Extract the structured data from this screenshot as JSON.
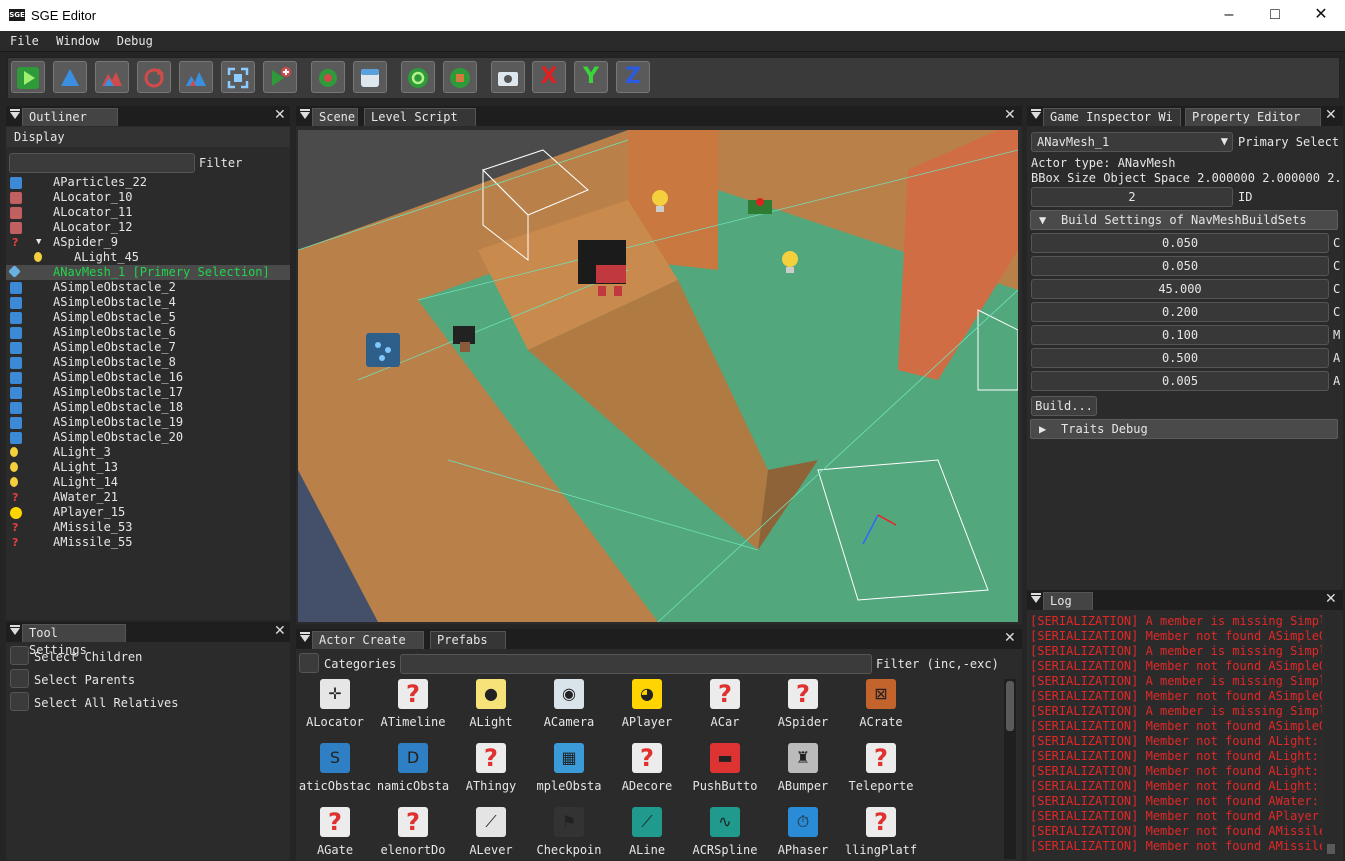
{
  "window": {
    "title": "SGE Editor",
    "logo": "SGE"
  },
  "menu": [
    "File",
    "Window",
    "Debug"
  ],
  "toolbar": {
    "buttons": [
      {
        "name": "play-button",
        "icon": "play-icon"
      },
      {
        "name": "translate-button",
        "icon": "arrow-up-icon"
      },
      {
        "name": "rotate-button",
        "icon": "mountains-icon"
      },
      {
        "name": "refresh-button",
        "icon": "rotate-icon"
      },
      {
        "name": "scale-button",
        "icon": "scale-icon"
      },
      {
        "name": "focus-button",
        "icon": "frame-icon"
      },
      {
        "name": "add-actor-button",
        "icon": "add-icon"
      },
      {
        "name": "snap-button",
        "icon": "snap-icon"
      },
      {
        "name": "window-button",
        "icon": "window-icon"
      },
      {
        "name": "reload-button",
        "icon": "reload-icon"
      },
      {
        "name": "reload-scripts-button",
        "icon": "recycle-icon"
      },
      {
        "name": "screenshot-button",
        "icon": "camera-icon"
      },
      {
        "name": "x-axis-button",
        "icon": "x-icon",
        "label": "X"
      },
      {
        "name": "y-axis-button",
        "icon": "y-icon",
        "label": "Y"
      },
      {
        "name": "z-axis-button",
        "icon": "z-icon",
        "label": "Z"
      }
    ]
  },
  "outliner": {
    "tab": "Outliner",
    "display": "Display",
    "filter_label": "Filter",
    "filter_value": "",
    "items": [
      {
        "label": "AParticles_22",
        "icon": "particles-icon",
        "indent": 0
      },
      {
        "label": "ALocator_10",
        "icon": "locator-icon",
        "indent": 0
      },
      {
        "label": "ALocator_11",
        "icon": "locator-icon",
        "indent": 0
      },
      {
        "label": "ALocator_12",
        "icon": "locator-icon",
        "indent": 0
      },
      {
        "label": "ASpider_9",
        "icon": "question-icon",
        "indent": 0,
        "arrow": "▼"
      },
      {
        "label": "ALight_45",
        "icon": "bulb-icon",
        "indent": 1
      },
      {
        "label": "ANavMesh_1 [Primery Selection]",
        "icon": "navmesh-icon",
        "indent": 0,
        "selected": true
      },
      {
        "label": "ASimpleObstacle_2",
        "icon": "obstacle-icon",
        "indent": 0
      },
      {
        "label": "ASimpleObstacle_4",
        "icon": "obstacle-icon",
        "indent": 0
      },
      {
        "label": "ASimpleObstacle_5",
        "icon": "obstacle-icon",
        "indent": 0
      },
      {
        "label": "ASimpleObstacle_6",
        "icon": "obstacle-icon",
        "indent": 0
      },
      {
        "label": "ASimpleObstacle_7",
        "icon": "obstacle-icon",
        "indent": 0
      },
      {
        "label": "ASimpleObstacle_8",
        "icon": "obstacle-icon",
        "indent": 0
      },
      {
        "label": "ASimpleObstacle_16",
        "icon": "obstacle-icon",
        "indent": 0
      },
      {
        "label": "ASimpleObstacle_17",
        "icon": "obstacle-icon",
        "indent": 0
      },
      {
        "label": "ASimpleObstacle_18",
        "icon": "obstacle-icon",
        "indent": 0
      },
      {
        "label": "ASimpleObstacle_19",
        "icon": "obstacle-icon",
        "indent": 0
      },
      {
        "label": "ASimpleObstacle_20",
        "icon": "obstacle-icon",
        "indent": 0
      },
      {
        "label": "ALight_3",
        "icon": "bulb-icon",
        "indent": 0
      },
      {
        "label": "ALight_13",
        "icon": "bulb-icon",
        "indent": 0
      },
      {
        "label": "ALight_14",
        "icon": "bulb-icon",
        "indent": 0
      },
      {
        "label": "AWater_21",
        "icon": "question-icon",
        "indent": 0
      },
      {
        "label": "APlayer_15",
        "icon": "pacman-icon",
        "indent": 0
      },
      {
        "label": "AMissile_53",
        "icon": "question-icon",
        "indent": 0
      },
      {
        "label": "AMissile_55",
        "icon": "question-icon",
        "indent": 0
      }
    ]
  },
  "tool_settings": {
    "tab": "Tool Settings",
    "options": [
      "Select Children",
      "Select Parents",
      "Select All Relatives"
    ]
  },
  "scene": {
    "tabs": [
      "Scene",
      "Level Script"
    ]
  },
  "actor_create": {
    "tabs": [
      "Actor Create",
      "Prefabs"
    ],
    "categories_label": "Categories",
    "filter_label": "Filter (inc,-exc)",
    "filter_value": "",
    "rows": [
      [
        {
          "label": "ALocator",
          "icon": "locator-icon"
        },
        {
          "label": "ATimeline",
          "icon": "question-icon"
        },
        {
          "label": "ALight",
          "icon": "bulb-icon"
        },
        {
          "label": "ACamera",
          "icon": "camera-icon"
        },
        {
          "label": "APlayer",
          "icon": "pacman-icon"
        },
        {
          "label": "ACar",
          "icon": "question-icon"
        },
        {
          "label": "ASpider",
          "icon": "question-icon"
        },
        {
          "label": "ACrate",
          "icon": "crate-icon"
        }
      ],
      [
        {
          "label": "aticObstac",
          "icon": "static-obstacle-icon"
        },
        {
          "label": "namicObsta",
          "icon": "dynamic-obstacle-icon"
        },
        {
          "label": "AThingy",
          "icon": "question-icon"
        },
        {
          "label": "mpleObsta",
          "icon": "obstacle-icon"
        },
        {
          "label": "ADecore",
          "icon": "question-icon"
        },
        {
          "label": "PushButto",
          "icon": "push-button-icon"
        },
        {
          "label": "ABumper",
          "icon": "bumper-icon"
        },
        {
          "label": "Teleporte",
          "icon": "question-icon"
        }
      ],
      [
        {
          "label": "AGate",
          "icon": "question-icon"
        },
        {
          "label": "elenortDo",
          "icon": "question-icon"
        },
        {
          "label": "ALever",
          "icon": "lever-icon"
        },
        {
          "label": "Checkpoin",
          "icon": "checkpoint-icon"
        },
        {
          "label": "ALine",
          "icon": "line-icon"
        },
        {
          "label": "ACRSpline",
          "icon": "spline-icon"
        },
        {
          "label": "APhaser",
          "icon": "phaser-icon"
        },
        {
          "label": "llingPlatf",
          "icon": "question-icon"
        }
      ]
    ]
  },
  "inspector": {
    "tabs": [
      "Game Inspector Wi",
      "Property Editor"
    ],
    "selected_actor": "ANavMesh_1",
    "primary_label": "Primary Select",
    "actor_type": "Actor type: ANavMesh",
    "bbox": "BBox Size Object Space  2.000000 2.000000 2.",
    "id_value": "2",
    "id_label": "ID",
    "build_settings_header": "Build Settings of NavMeshBuildSets",
    "build_values": [
      {
        "value": "0.050",
        "suffix": "C"
      },
      {
        "value": "0.050",
        "suffix": "C"
      },
      {
        "value": "45.000",
        "suffix": "C"
      },
      {
        "value": "0.200",
        "suffix": "C"
      },
      {
        "value": "0.100",
        "suffix": "M"
      },
      {
        "value": "0.500",
        "suffix": "A"
      },
      {
        "value": "0.005",
        "suffix": "A"
      }
    ],
    "build_button": "Build...",
    "traits_header": "Traits Debug"
  },
  "log": {
    "tab": "Log",
    "lines": [
      "[SERIALIZATION] A member is missing Simpl",
      "[SERIALIZATION] Member not found ASimpleOb",
      "[SERIALIZATION] A member is missing Simpl",
      "[SERIALIZATION] Member not found ASimpleOb",
      "[SERIALIZATION] A member is missing Simpl",
      "[SERIALIZATION] Member not found ASimpleOb",
      "[SERIALIZATION] A member is missing Simpl",
      "[SERIALIZATION] Member not found ASimpleOb",
      "[SERIALIZATION] Member not found ALight::r",
      "[SERIALIZATION] Member not found ALight::r",
      "[SERIALIZATION] Member not found ALight::r",
      "[SERIALIZATION] Member not found ALight::r",
      "[SERIALIZATION] Member not found AWater::r",
      "[SERIALIZATION] Member not found APlayer:",
      "[SERIALIZATION] Member not found AMissile",
      "[SERIALIZATION] Member not found AMissile"
    ]
  },
  "colors": {
    "selection": "#22d44a",
    "log_error": "#e02828",
    "navmesh": "#3fb58c",
    "floor": "#c98a4e"
  }
}
